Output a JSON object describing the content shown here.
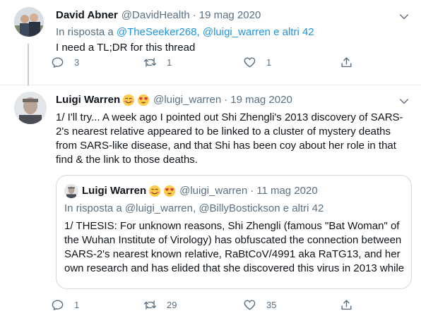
{
  "tweet1": {
    "name": "David Abner",
    "handle": "@DavidHealth",
    "sep": "·",
    "date": "19 mag 2020",
    "reply_prefix": "In risposta a",
    "reply_links": "@TheSeeker268, @luigi_warren e altri 42",
    "text": "I need a TL;DR for this thread",
    "replies": "3",
    "retweets": "1",
    "likes": "1"
  },
  "tweet2": {
    "name": "Luigi Warren",
    "handle": "@luigi_warren",
    "sep": "·",
    "date": "19 mag 2020",
    "text": "1/ I'll try... A week ago I pointed out Shi Zhengli's 2013 discovery of SARS-2's nearest relative appeared to be linked to a cluster of mystery deaths from SARS-like disease, and that Shi has been coy about her role in that find & the link to those deaths.",
    "replies": "1",
    "retweets": "29",
    "likes": "35"
  },
  "quoted": {
    "name": "Luigi Warren",
    "handle": "@luigi_warren",
    "sep": "·",
    "date": "11 mag 2020",
    "reply_prefix": "In risposta a",
    "reply_links": "@luigi_warren, @BillyBostickson e altri 42",
    "text": "1/ THESIS: For unknown reasons, Shi Zhengli (famous \"Bat Woman\" of the Wuhan Institute of Virology) has obfuscated the connection between SARS-2's nearest known relative, RaBtCoV/4991 aka RaTG13, and her own research and has elided that she discovered this virus in 2013 while"
  },
  "icons": {
    "reply": "reply-icon",
    "retweet": "retweet-icon",
    "like": "heart-icon",
    "share": "share-icon",
    "more": "more-icon",
    "emoji_smile": "smiling-face-emoji",
    "emoji_hearts": "heart-eyes-emoji"
  },
  "colors": {
    "link": "#1b95e0",
    "secondary_text": "#5b7083",
    "primary_text": "#0f1419",
    "border": "#cfd9de"
  }
}
